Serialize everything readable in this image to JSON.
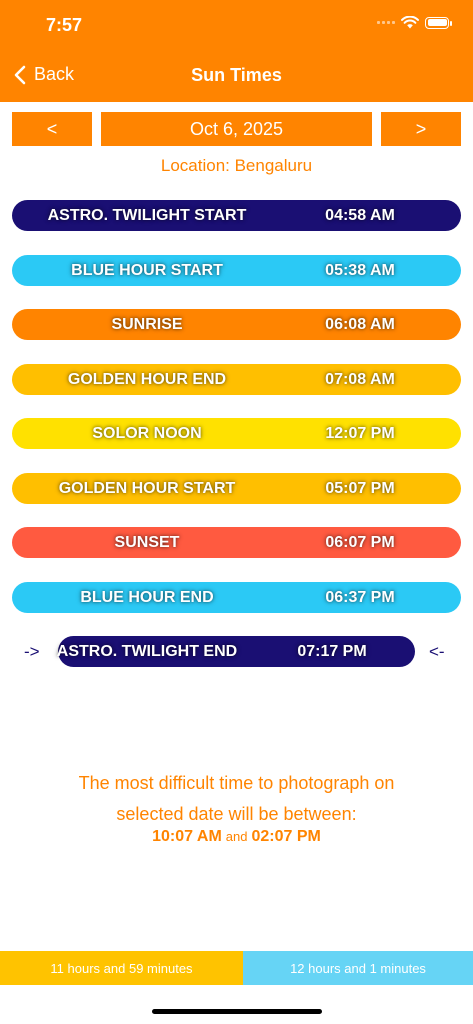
{
  "status": {
    "time": "7:57"
  },
  "nav": {
    "back_label": "Back",
    "title": "Sun Times"
  },
  "date_nav": {
    "prev_label": "<",
    "date": "Oct 6, 2025",
    "next_label": ">"
  },
  "location": "Location: Bengaluru",
  "events": [
    {
      "name": "ASTRO. TWILIGHT START",
      "time": "04:58 AM",
      "color": "#1a0f73"
    },
    {
      "name": "BLUE HOUR START",
      "time": "05:38 AM",
      "color": "#2bc9f5"
    },
    {
      "name": "SUNRISE",
      "time": "06:08 AM",
      "color": "#ff8400"
    },
    {
      "name": "GOLDEN HOUR END",
      "time": "07:08 AM",
      "color": "#ffbf00"
    },
    {
      "name": "SOLOR NOON",
      "time": "12:07 PM",
      "color": "#ffe100"
    },
    {
      "name": "GOLDEN HOUR START",
      "time": "05:07 PM",
      "color": "#ffbf00"
    },
    {
      "name": "SUNSET",
      "time": "06:07 PM",
      "color": "#ff5a40"
    },
    {
      "name": "BLUE HOUR END",
      "time": "06:37 PM",
      "color": "#2bc9f5"
    },
    {
      "name": "ASTRO. TWILIGHT END",
      "time": "07:17 PM",
      "color": "#1a0f73"
    }
  ],
  "current_marker": {
    "left": "->",
    "right": "<-"
  },
  "message": {
    "line1": "The most difficult time to photograph on",
    "line2": "selected date will be between:",
    "start": "10:07 AM",
    "and": "and",
    "end": "02:07 PM"
  },
  "footer": {
    "day_length": "11 hours and 59 minutes",
    "night_length": "12 hours and 1 minutes"
  },
  "colors": {
    "accent": "#ff8400",
    "day": "#ffc300",
    "night": "#66d4f5"
  }
}
